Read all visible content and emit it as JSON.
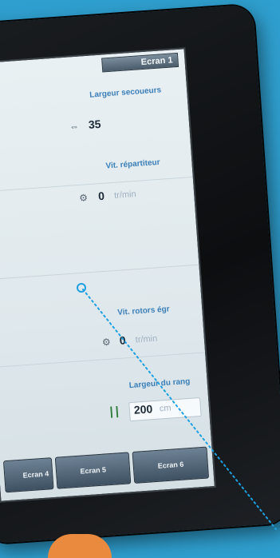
{
  "screen": {
    "title": "Ecran 1"
  },
  "fields": {
    "largeur_secoueurs": {
      "label": "Largeur secoueurs",
      "value": "35"
    },
    "vit_repartiteur": {
      "label": "Vit. répartiteur",
      "value": "0",
      "unit": "tr/min"
    },
    "vit_rotors_egr": {
      "label": "Vit. rotors égr",
      "value": "0",
      "unit": "tr/min"
    },
    "largeur_du_rang": {
      "label": "Largeur du rang",
      "value": "200",
      "unit": "cm"
    }
  },
  "tabs": [
    {
      "label": "Ecran 4"
    },
    {
      "label": "Ecran 5"
    },
    {
      "label": "Ecran 6"
    }
  ],
  "colors": {
    "pointer": "#1ea0e0",
    "background": "#2f9fcf"
  }
}
